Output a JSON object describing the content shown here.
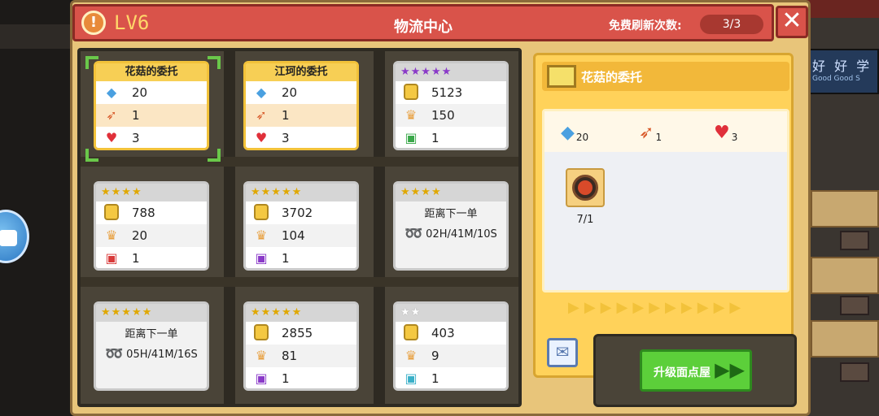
{
  "header": {
    "level": "LV6",
    "title": "物流中心",
    "refresh_label": "免费刷新次数:",
    "refresh_count": "3/3",
    "close": "✕"
  },
  "cards": [
    {
      "title": "花菇的委托",
      "rows": [
        {
          "icon": "crystal-icon",
          "value": "20"
        },
        {
          "icon": "rocket-icon",
          "value": "1"
        },
        {
          "icon": "heart-icon",
          "value": "3"
        }
      ]
    },
    {
      "title": "江珂的委托",
      "rows": [
        {
          "icon": "crystal-icon",
          "value": "20"
        },
        {
          "icon": "rocket-icon",
          "value": "1"
        },
        {
          "icon": "heart-icon",
          "value": "3"
        }
      ]
    },
    {
      "stars": "★★★★★",
      "rows": [
        {
          "icon": "coin-icon",
          "value": "5123"
        },
        {
          "icon": "chef-hat-icon",
          "value": "150"
        },
        {
          "icon": "gift-green-icon",
          "value": "1"
        }
      ]
    },
    {
      "stars": "★★★★",
      "rows": [
        {
          "icon": "coin-icon",
          "value": "788"
        },
        {
          "icon": "chef-hat-icon",
          "value": "20"
        },
        {
          "icon": "gift-red-icon",
          "value": "1"
        }
      ]
    },
    {
      "stars": "★★★★★",
      "rows": [
        {
          "icon": "coin-icon",
          "value": "3702"
        },
        {
          "icon": "chef-hat-icon",
          "value": "104"
        },
        {
          "icon": "gift-purple-icon",
          "value": "1"
        }
      ]
    },
    {
      "stars": "★★★★",
      "wait_label": "距离下一单",
      "wait_time": "02H/41M/10S"
    },
    {
      "stars": "★★★★★",
      "wait_label": "距离下一单",
      "wait_time": "05H/41M/16S"
    },
    {
      "stars": "★★★★★",
      "rows": [
        {
          "icon": "coin-icon",
          "value": "2855"
        },
        {
          "icon": "chef-hat-icon",
          "value": "81"
        },
        {
          "icon": "gift-purple-icon",
          "value": "1"
        }
      ]
    },
    {
      "stars": "★★",
      "rows": [
        {
          "icon": "coin-icon",
          "value": "403"
        },
        {
          "icon": "chef-hat-icon",
          "value": "9"
        },
        {
          "icon": "gift-cyan-icon",
          "value": "1"
        }
      ]
    }
  ],
  "detail": {
    "title": "花菇的委托",
    "rewards": [
      {
        "icon": "crystal-icon",
        "value": "20"
      },
      {
        "icon": "rocket-icon",
        "value": "1"
      },
      {
        "icon": "heart-icon",
        "value": "3"
      }
    ],
    "food_count": "7/1",
    "arrows": "▶▶▶▶▶▶▶▶▶▶▶"
  },
  "upgrade_button": "升级面点屋",
  "background": {
    "sign_text": "好 好 学",
    "sign_sub": "Good Good S"
  },
  "colors": {
    "header_red": "#d9534a",
    "panel_gold": "#ffd25a",
    "selected_green": "#6ac84a",
    "upgrade_green": "#5ccf3a"
  }
}
